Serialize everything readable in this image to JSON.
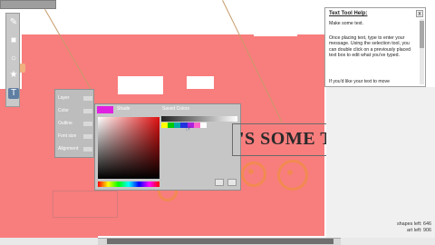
{
  "help_panel": {
    "title": "Text Tool Help:",
    "close": "x",
    "paragraphs": [
      "Make some text.",
      "Once placing text, type to enter your message.  Using the selection tool, you can double click on a previously placed text box to edit what you've typed.",
      "If you'd like your text to move"
    ]
  },
  "canvas_text": "'S SOME TEXT",
  "properties_panel": {
    "rows": [
      "Layer",
      "Color",
      "Outline",
      "Font size",
      "Alignment"
    ]
  },
  "color_picker": {
    "title": "Shade",
    "saved_label": "Saved Colors",
    "current_color": "#e020e0",
    "saved_colors": [
      "#ffff00",
      "#00cc00",
      "#00aaaa",
      "#2233dd",
      "#aa22dd",
      "#ff66cc",
      "#ffffff"
    ]
  },
  "status": {
    "shapes_left": "shapes left: 646",
    "art_left": "art left: 906"
  },
  "toolbar": {
    "tools": [
      "pencil-icon",
      "shape-icon",
      "circle-icon",
      "star-icon",
      "text-icon"
    ]
  },
  "colors": {
    "canvas_fill": "#f87d7d",
    "accent_shape": "#f28a52",
    "panel_gray": "#c6c6c6"
  }
}
